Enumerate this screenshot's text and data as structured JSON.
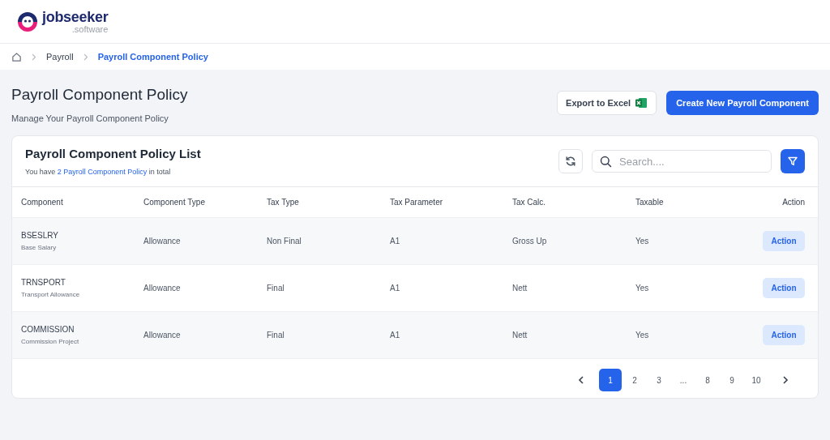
{
  "logo": {
    "name": "jobseeker",
    "suffix": ".software"
  },
  "breadcrumb": [
    {
      "label": "Payroll",
      "selected": false
    },
    {
      "label": "Payroll Component Policy",
      "selected": true
    }
  ],
  "page": {
    "title": "Payroll Component Policy",
    "subtitle": "Manage Your Payroll Component Policy"
  },
  "buttons": {
    "export": "Export to Excel",
    "create": "Create New Payroll Component"
  },
  "card": {
    "title": "Payroll Component Policy List",
    "summary_before": "You have",
    "summary_link": "2 Payroll Component Policy",
    "summary_after": "in total"
  },
  "search": {
    "placeholder": "Search...."
  },
  "table": {
    "columns": [
      "Component",
      "Component Type",
      "Tax Type",
      "Tax Parameter",
      "Tax Calc.",
      "Taxable",
      "Action"
    ],
    "rows": [
      {
        "code": "BSESLRY",
        "name": "Base Salary",
        "component_type": "Allowance",
        "tax_type": "Non Final",
        "tax_parameter": "A1",
        "tax_calc": "Gross Up",
        "taxable": "Yes",
        "action": "Action"
      },
      {
        "code": "TRNSPORT",
        "name": "Transport Allowance",
        "component_type": "Allowance",
        "tax_type": "Final",
        "tax_parameter": "A1",
        "tax_calc": "Nett",
        "taxable": "Yes",
        "action": "Action"
      },
      {
        "code": "COMMISSION",
        "name": "Commission Project",
        "component_type": "Allowance",
        "tax_type": "Final",
        "tax_parameter": "A1",
        "tax_calc": "Nett",
        "taxable": "Yes",
        "action": "Action"
      }
    ]
  },
  "pagination": [
    {
      "label": "1",
      "selected": true
    },
    {
      "label": "2",
      "selected": false
    },
    {
      "label": "3",
      "selected": false
    },
    {
      "label": "...",
      "selected": false
    },
    {
      "label": "8",
      "selected": false
    },
    {
      "label": "9",
      "selected": false
    },
    {
      "label": "10",
      "selected": false
    }
  ]
}
